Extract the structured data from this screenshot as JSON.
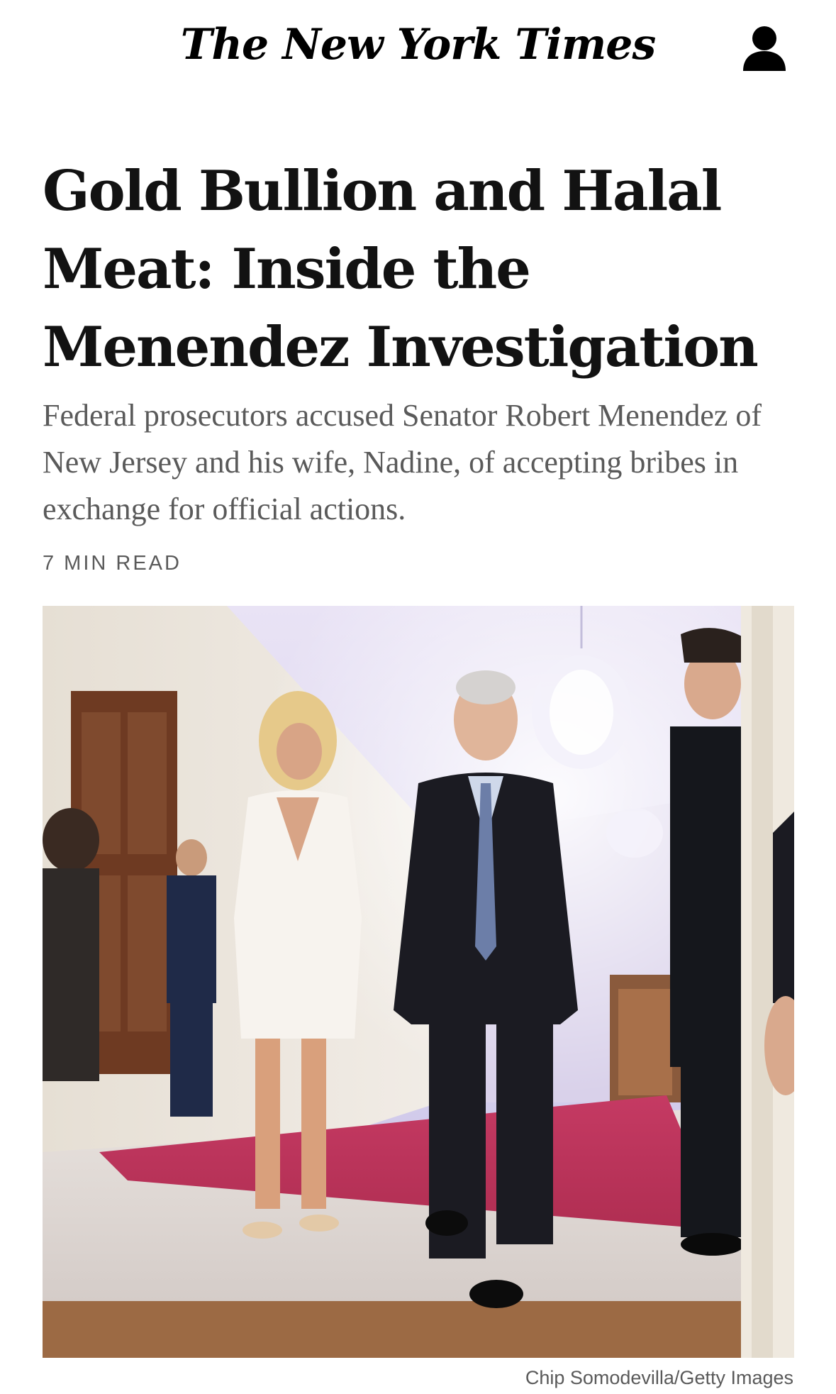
{
  "masthead": {
    "logo_text": "The New York Times",
    "account_icon": "person-icon"
  },
  "article": {
    "headline": "Gold Bullion and Halal Meat: Inside the Menendez Investigation",
    "summary": "Federal prosecutors accused Senator Robert Menendez of New Jersey and his wife, Nadine, of accepting bribes in exchange for official actions.",
    "read_time": "7 MIN READ",
    "photo_credit": "Chip Somodevilla/Getty Images"
  },
  "colors": {
    "text_primary": "#121212",
    "text_secondary": "#5a5a5a",
    "background": "#ffffff"
  }
}
